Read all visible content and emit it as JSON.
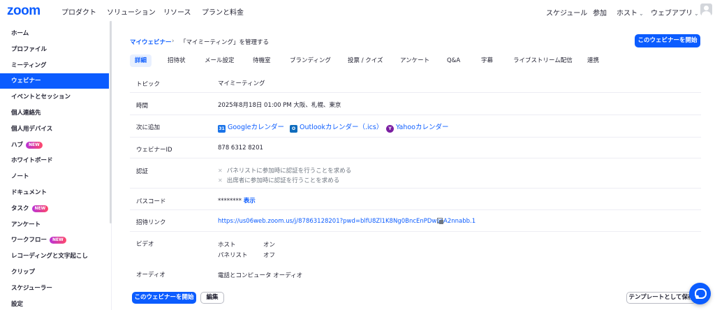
{
  "logo": "zoom",
  "topnav": {
    "left": [
      "プロダクト",
      "ソリューション",
      "リソース",
      "プランと料金"
    ],
    "schedule": "スケジュール",
    "join": "参加",
    "host": "ホスト",
    "webapp": "ウェブアプリ"
  },
  "sidebar": {
    "items": [
      {
        "label": "ホーム"
      },
      {
        "label": "プロファイル"
      },
      {
        "label": "ミーティング"
      },
      {
        "label": "ウェビナー"
      },
      {
        "label": "イベントとセッション"
      },
      {
        "label": "個人連絡先"
      },
      {
        "label": "個人用デバイス"
      },
      {
        "label": "ハブ"
      },
      {
        "label": "ホワイトボード"
      },
      {
        "label": "ノート"
      },
      {
        "label": "ドキュメント"
      },
      {
        "label": "タスク"
      },
      {
        "label": "アンケート"
      },
      {
        "label": "ワークフロー"
      },
      {
        "label": "レコーディングと文字起こし"
      },
      {
        "label": "クリップ"
      },
      {
        "label": "スケジューラー"
      },
      {
        "label": "設定"
      }
    ],
    "new_badge": "NEW"
  },
  "breadcrumb": {
    "link": "マイウェビナー",
    "separator": "›",
    "current": "「マイミーティング」を管理する"
  },
  "start_button": "このウェビナーを開始",
  "tabs": [
    "詳細",
    "招待状",
    "メール設定",
    "待機室",
    "ブランディング",
    "投票 / クイズ",
    "アンケート",
    "Q&A",
    "字幕",
    "ライブストリーム配信",
    "連携"
  ],
  "details": {
    "topic_label": "トピック",
    "topic": "マイミーティング",
    "time_label": "時間",
    "time": "2025年8月18日 01:00 PM 大阪、札幌、東京",
    "add_label": "次に追加",
    "calendars": {
      "google": "Googleカレンダー",
      "outlook": "Outlookカレンダー（.ics）",
      "yahoo": "Yahooカレンダー"
    },
    "webinar_id_label": "ウェビナーID",
    "webinar_id": "878 6312 8201",
    "auth_label": "認証",
    "auth_panelist": "パネリストに参加時に認証を行うことを求める",
    "auth_attendee": "出席者に参加時に認証を行うことを求める",
    "passcode_label": "パスコード",
    "passcode": "********",
    "passcode_show": "表示",
    "invite_link_label": "招待リンク",
    "invite_link": "https://us06web.zoom.us/j/87863128201?pwd=blfU8Zl1K8Ng0BncEnPDwsoA2nnabb.1",
    "video_label": "ビデオ",
    "video_host_label": "ホスト",
    "video_host_value": "オン",
    "video_panelist_label": "パネリスト",
    "video_panelist_value": "オフ",
    "audio_label": "オーディオ",
    "audio_value": "電話とコンピュータ オーディオ"
  },
  "bottom": {
    "start": "このウェビナーを開始",
    "edit": "編集",
    "template": "テンプレートとして保存"
  }
}
